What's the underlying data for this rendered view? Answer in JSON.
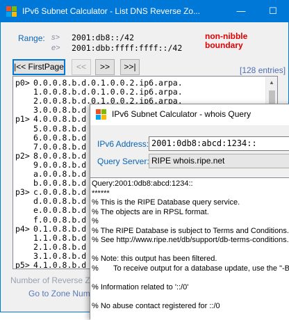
{
  "main_window": {
    "title": "IPv6 Subnet Calculator - List DNS Reverse Zo...",
    "controls": {
      "minimize": "—",
      "maximize": "☐"
    }
  },
  "range": {
    "label": "Range:",
    "start_prefix": "s>",
    "start_value": "2001:db8::/42",
    "end_prefix": "e>",
    "end_value": "2001:dbb:ffff:ffff::/42",
    "warning_line1": "non-nibble",
    "warning_line2": "boundary"
  },
  "nav": {
    "first_page": "|<< FirstPage",
    "prev": "<<",
    "next": ">>",
    "last": ">>|",
    "entries": "[128 entries]"
  },
  "list": {
    "rows": [
      {
        "label": "p0>",
        "value": "0.0.0.8.b.d.0.1.0.0.2.ip6.arpa."
      },
      {
        "label": "",
        "value": "1.0.0.8.b.d.0.1.0.0.2.ip6.arpa."
      },
      {
        "label": "",
        "value": "2.0.0.8.b.d.0.1.0.0.2.ip6.arpa."
      },
      {
        "label": "",
        "value": "3.0.0.8.b.d"
      },
      {
        "label": "p1>",
        "value": "4.0.0.8.b.d"
      },
      {
        "label": "",
        "value": "5.0.0.8.b.d"
      },
      {
        "label": "",
        "value": "6.0.0.8.b.d"
      },
      {
        "label": "",
        "value": "7.0.0.8.b.d"
      },
      {
        "label": "p2>",
        "value": "8.0.0.8.b.d"
      },
      {
        "label": "",
        "value": "9.0.0.8.b.d"
      },
      {
        "label": "",
        "value": "a.0.0.8.b.d"
      },
      {
        "label": "",
        "value": "b.0.0.8.b.d"
      },
      {
        "label": "p3>",
        "value": "c.0.0.8.b.d"
      },
      {
        "label": "",
        "value": "d.0.0.8.b.d"
      },
      {
        "label": "",
        "value": "e.0.0.8.b.d"
      },
      {
        "label": "",
        "value": "f.0.0.8.b.d"
      },
      {
        "label": "p4>",
        "value": "0.1.0.8.b.d"
      },
      {
        "label": "",
        "value": "1.1.0.8.b.d"
      },
      {
        "label": "",
        "value": "2.1.0.8.b.d"
      },
      {
        "label": "",
        "value": "3.1.0.8.b.d"
      },
      {
        "label": "p5>",
        "value": "4.1.0.8.b.d"
      }
    ]
  },
  "footer": {
    "reverse_zones_label": "Number of Reverse Zon",
    "goto_zone_label": "Go to Zone Num"
  },
  "whois_window": {
    "title": "IPv6 Subnet Calculator - whois Query",
    "address_label": "IPv6 Address:",
    "address_value": "2001:0db8:abcd:1234::",
    "server_label": "Query Server:",
    "server_value": "RIPE whois.ripe.net",
    "output_lines": [
      "Query:2001:0db8:abcd:1234::",
      "******",
      "% This is the RIPE Database query service.",
      "% The objects are in RPSL format.",
      "%",
      "% The RIPE Database is subject to Terms and Conditions.",
      "% See http://www.ripe.net/db/support/db-terms-conditions.p",
      "",
      "% Note: this output has been filtered.",
      "%       To receive output for a database update, use the \"-B\"",
      "",
      "% Information related to '::/0'",
      "",
      "% No abuse contact registered for ::/0"
    ]
  },
  "colors": {
    "titlebar_active": "#0078d7",
    "label_blue": "#0a64b4",
    "warning_red": "#e00000"
  }
}
